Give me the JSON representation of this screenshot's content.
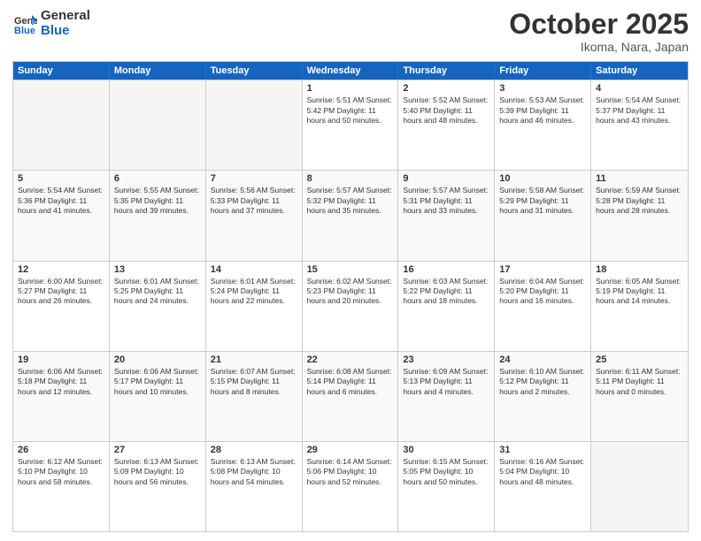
{
  "header": {
    "logo_general": "General",
    "logo_blue": "Blue",
    "month": "October 2025",
    "location": "Ikoma, Nara, Japan"
  },
  "days_of_week": [
    "Sunday",
    "Monday",
    "Tuesday",
    "Wednesday",
    "Thursday",
    "Friday",
    "Saturday"
  ],
  "rows": [
    {
      "cells": [
        {
          "day": "",
          "empty": true
        },
        {
          "day": "",
          "empty": true
        },
        {
          "day": "",
          "empty": true
        },
        {
          "day": "1",
          "info": "Sunrise: 5:51 AM\nSunset: 5:42 PM\nDaylight: 11 hours\nand 50 minutes."
        },
        {
          "day": "2",
          "info": "Sunrise: 5:52 AM\nSunset: 5:40 PM\nDaylight: 11 hours\nand 48 minutes."
        },
        {
          "day": "3",
          "info": "Sunrise: 5:53 AM\nSunset: 5:39 PM\nDaylight: 11 hours\nand 46 minutes."
        },
        {
          "day": "4",
          "info": "Sunrise: 5:54 AM\nSunset: 5:37 PM\nDaylight: 11 hours\nand 43 minutes."
        }
      ]
    },
    {
      "alt": true,
      "cells": [
        {
          "day": "5",
          "info": "Sunrise: 5:54 AM\nSunset: 5:36 PM\nDaylight: 11 hours\nand 41 minutes."
        },
        {
          "day": "6",
          "info": "Sunrise: 5:55 AM\nSunset: 5:35 PM\nDaylight: 11 hours\nand 39 minutes."
        },
        {
          "day": "7",
          "info": "Sunrise: 5:56 AM\nSunset: 5:33 PM\nDaylight: 11 hours\nand 37 minutes."
        },
        {
          "day": "8",
          "info": "Sunrise: 5:57 AM\nSunset: 5:32 PM\nDaylight: 11 hours\nand 35 minutes."
        },
        {
          "day": "9",
          "info": "Sunrise: 5:57 AM\nSunset: 5:31 PM\nDaylight: 11 hours\nand 33 minutes."
        },
        {
          "day": "10",
          "info": "Sunrise: 5:58 AM\nSunset: 5:29 PM\nDaylight: 11 hours\nand 31 minutes."
        },
        {
          "day": "11",
          "info": "Sunrise: 5:59 AM\nSunset: 5:28 PM\nDaylight: 11 hours\nand 28 minutes."
        }
      ]
    },
    {
      "cells": [
        {
          "day": "12",
          "info": "Sunrise: 6:00 AM\nSunset: 5:27 PM\nDaylight: 11 hours\nand 26 minutes."
        },
        {
          "day": "13",
          "info": "Sunrise: 6:01 AM\nSunset: 5:25 PM\nDaylight: 11 hours\nand 24 minutes."
        },
        {
          "day": "14",
          "info": "Sunrise: 6:01 AM\nSunset: 5:24 PM\nDaylight: 11 hours\nand 22 minutes."
        },
        {
          "day": "15",
          "info": "Sunrise: 6:02 AM\nSunset: 5:23 PM\nDaylight: 11 hours\nand 20 minutes."
        },
        {
          "day": "16",
          "info": "Sunrise: 6:03 AM\nSunset: 5:22 PM\nDaylight: 11 hours\nand 18 minutes."
        },
        {
          "day": "17",
          "info": "Sunrise: 6:04 AM\nSunset: 5:20 PM\nDaylight: 11 hours\nand 16 minutes."
        },
        {
          "day": "18",
          "info": "Sunrise: 6:05 AM\nSunset: 5:19 PM\nDaylight: 11 hours\nand 14 minutes."
        }
      ]
    },
    {
      "alt": true,
      "cells": [
        {
          "day": "19",
          "info": "Sunrise: 6:06 AM\nSunset: 5:18 PM\nDaylight: 11 hours\nand 12 minutes."
        },
        {
          "day": "20",
          "info": "Sunrise: 6:06 AM\nSunset: 5:17 PM\nDaylight: 11 hours\nand 10 minutes."
        },
        {
          "day": "21",
          "info": "Sunrise: 6:07 AM\nSunset: 5:15 PM\nDaylight: 11 hours\nand 8 minutes."
        },
        {
          "day": "22",
          "info": "Sunrise: 6:08 AM\nSunset: 5:14 PM\nDaylight: 11 hours\nand 6 minutes."
        },
        {
          "day": "23",
          "info": "Sunrise: 6:09 AM\nSunset: 5:13 PM\nDaylight: 11 hours\nand 4 minutes."
        },
        {
          "day": "24",
          "info": "Sunrise: 6:10 AM\nSunset: 5:12 PM\nDaylight: 11 hours\nand 2 minutes."
        },
        {
          "day": "25",
          "info": "Sunrise: 6:11 AM\nSunset: 5:11 PM\nDaylight: 11 hours\nand 0 minutes."
        }
      ]
    },
    {
      "cells": [
        {
          "day": "26",
          "info": "Sunrise: 6:12 AM\nSunset: 5:10 PM\nDaylight: 10 hours\nand 58 minutes."
        },
        {
          "day": "27",
          "info": "Sunrise: 6:13 AM\nSunset: 5:09 PM\nDaylight: 10 hours\nand 56 minutes."
        },
        {
          "day": "28",
          "info": "Sunrise: 6:13 AM\nSunset: 5:08 PM\nDaylight: 10 hours\nand 54 minutes."
        },
        {
          "day": "29",
          "info": "Sunrise: 6:14 AM\nSunset: 5:06 PM\nDaylight: 10 hours\nand 52 minutes."
        },
        {
          "day": "30",
          "info": "Sunrise: 6:15 AM\nSunset: 5:05 PM\nDaylight: 10 hours\nand 50 minutes."
        },
        {
          "day": "31",
          "info": "Sunrise: 6:16 AM\nSunset: 5:04 PM\nDaylight: 10 hours\nand 48 minutes."
        },
        {
          "day": "",
          "empty": true
        }
      ]
    }
  ]
}
